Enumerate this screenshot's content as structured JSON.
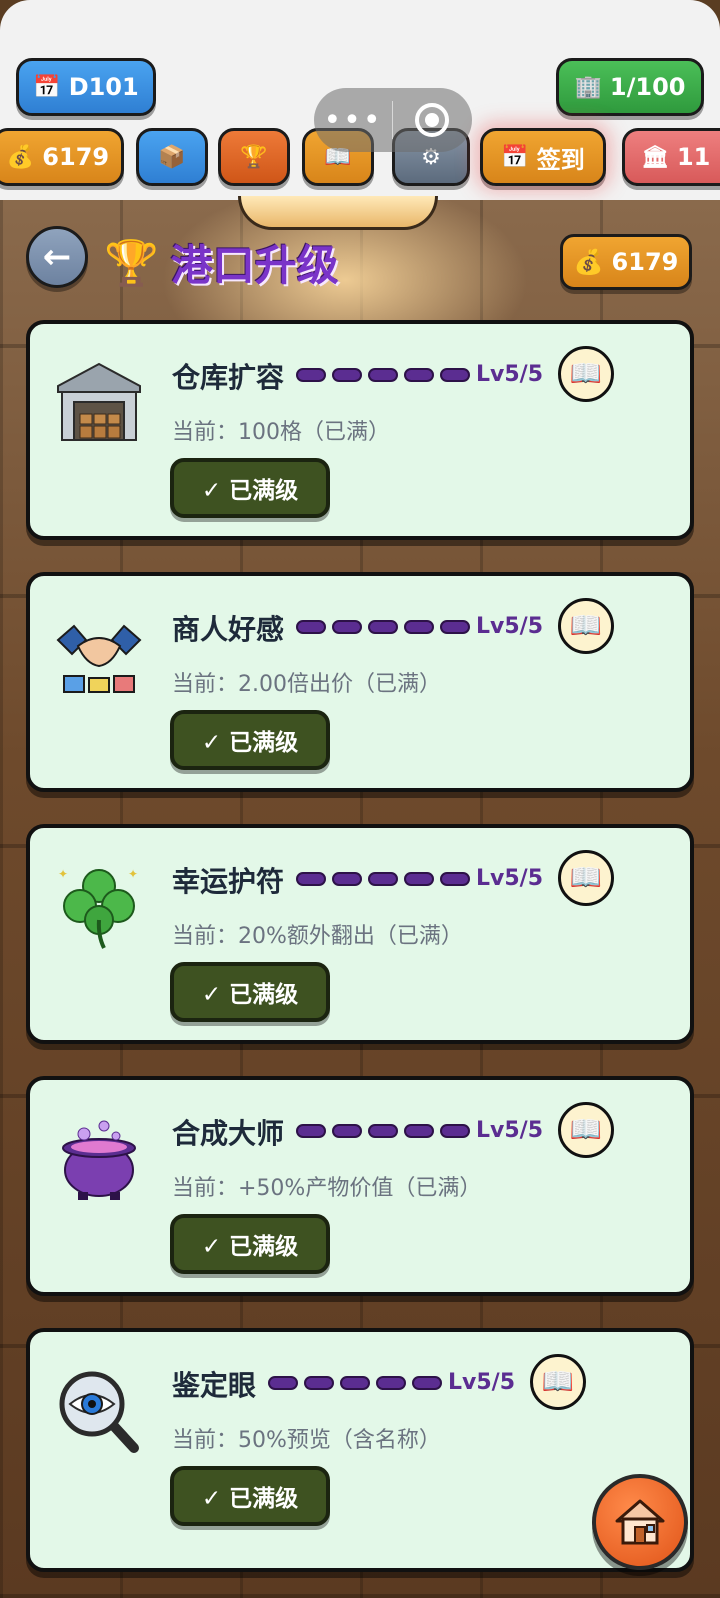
{
  "hud": {
    "day": "D101",
    "capacity": "1/100",
    "coins": "6179",
    "checkin_label": "签到",
    "bank_value": "11"
  },
  "header": {
    "title": "港口升级",
    "coins": "6179"
  },
  "cards": [
    {
      "name": "仓库扩容",
      "level": "Lv5/5",
      "desc": "当前：100格（已满）",
      "button": "✓ 已满级",
      "icon": "warehouse-icon"
    },
    {
      "name": "商人好感",
      "level": "Lv5/5",
      "desc": "当前：2.00倍出价（已满）",
      "button": "✓ 已满级",
      "icon": "handshake-icon"
    },
    {
      "name": "幸运护符",
      "level": "Lv5/5",
      "desc": "当前：20%额外翻出（已满）",
      "button": "✓ 已满级",
      "icon": "clover-icon"
    },
    {
      "name": "合成大师",
      "level": "Lv5/5",
      "desc": "当前：+50%产物价值（已满）",
      "button": "✓ 已满级",
      "icon": "cauldron-icon"
    },
    {
      "name": "鉴定眼",
      "level": "Lv5/5",
      "desc": "当前：50%预览（含名称）",
      "button": "✓ 已满级",
      "icon": "magnifier-eye-icon"
    }
  ],
  "colors": {
    "accent_purple": "#7a34c8",
    "card_bg": "#e3f8e8",
    "max_button": "#3e5221",
    "coin_orange": "#f0a531"
  }
}
